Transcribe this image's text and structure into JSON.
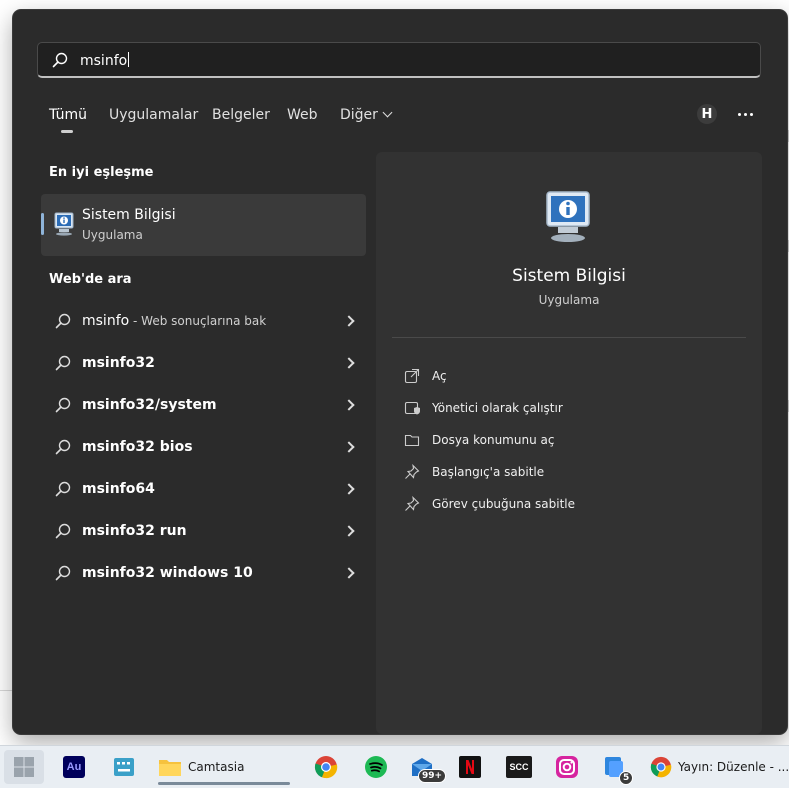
{
  "search": {
    "query": "msinfo"
  },
  "tabs": [
    {
      "label": "Tümü",
      "active": true
    },
    {
      "label": "Uygulamalar"
    },
    {
      "label": "Belgeler"
    },
    {
      "label": "Web"
    },
    {
      "label": "Diğer"
    }
  ],
  "account_initial": "H",
  "best_match": {
    "heading": "En iyi eşleşme",
    "name": "Sistem Bilgisi",
    "type": "Uygulama"
  },
  "web": {
    "heading": "Web'de ara",
    "items": [
      {
        "text": "msinfo",
        "suffix": " - Web sonuçlarına bak"
      },
      {
        "text": "msinfo32"
      },
      {
        "text": "msinfo32/system"
      },
      {
        "text": "msinfo32 bios"
      },
      {
        "text": "msinfo64"
      },
      {
        "text": "msinfo32 run"
      },
      {
        "text": "msinfo32 windows 10"
      }
    ]
  },
  "detail": {
    "title": "Sistem Bilgisi",
    "subtitle": "Uygulama",
    "actions": [
      {
        "label": "Aç",
        "icon": "open-external-icon"
      },
      {
        "label": "Yönetici olarak çalıştır",
        "icon": "run-as-admin-icon"
      },
      {
        "label": "Dosya konumunu aç",
        "icon": "folder-icon"
      },
      {
        "label": "Başlangıç'a sabitle",
        "icon": "pin-icon"
      },
      {
        "label": "Görev çubuğuna sabitle",
        "icon": "pin-icon"
      }
    ]
  },
  "taskbar": {
    "camtasia_label": "Camtasia",
    "adobe_label": "Au",
    "scc_label": "SCC",
    "mail_badge": "99+",
    "notes_badge": "5",
    "chrome_window_label": "Yayın: Düzenle - ..."
  }
}
